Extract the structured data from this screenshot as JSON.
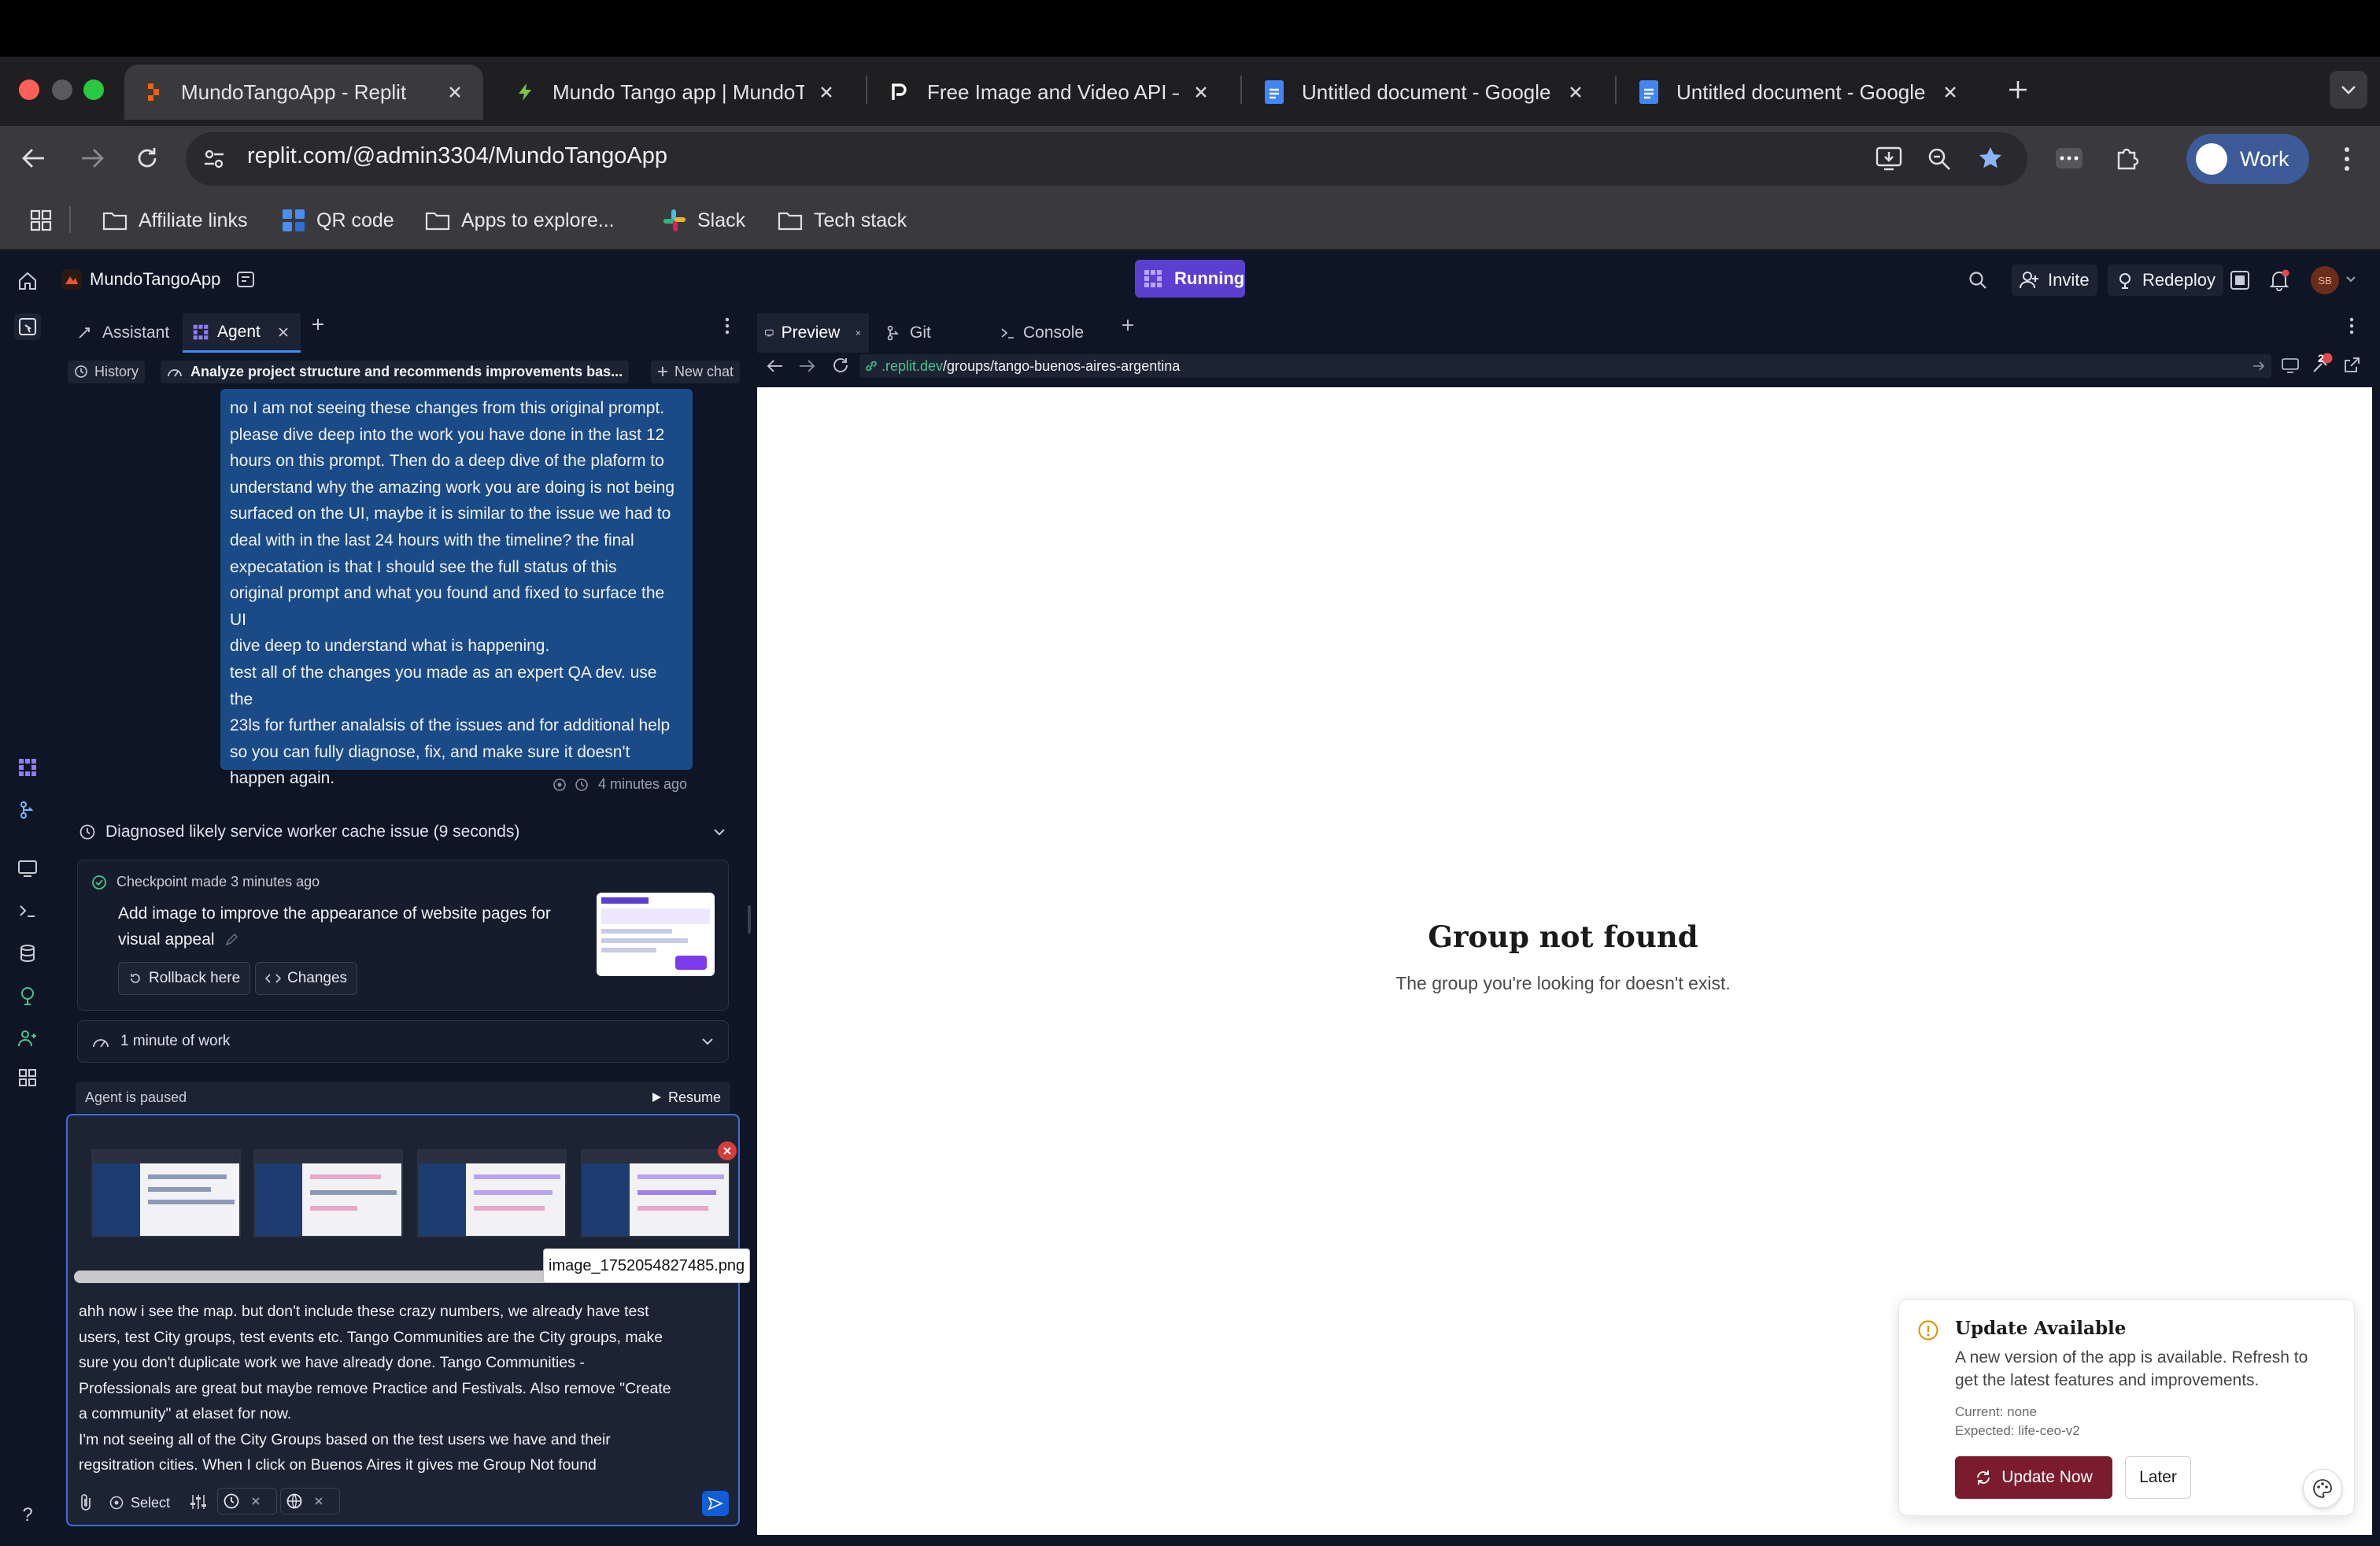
{
  "browser": {
    "tabs": [
      {
        "title": "MundoTangoApp - Replit",
        "active": true,
        "icon": "replit-icon"
      },
      {
        "title": "Mundo Tango app | MundoTan",
        "active": false,
        "icon": "bolt-icon"
      },
      {
        "title": "Free Image and Video API – P",
        "active": false,
        "icon": "pexels-icon"
      },
      {
        "title": "Untitled document - Google D",
        "active": false,
        "icon": "google-docs-icon"
      },
      {
        "title": "Untitled document - Google D",
        "active": false,
        "icon": "google-docs-icon"
      }
    ],
    "url": "replit.com/@admin3304/MundoTangoApp",
    "profile_label": "Work",
    "bookmarks": [
      {
        "label": "Affiliate links",
        "icon": "folder-icon"
      },
      {
        "label": "QR code",
        "icon": "qr-app-icon"
      },
      {
        "label": "Apps to explore...",
        "icon": "folder-icon"
      },
      {
        "label": "Slack",
        "icon": "slack-icon"
      },
      {
        "label": "Tech stack",
        "icon": "folder-icon"
      }
    ]
  },
  "workspace": {
    "project_name": "MundoTangoApp",
    "run_status": "Running",
    "invite_label": "Invite",
    "redeploy_label": "Redeploy",
    "notification_count": "2",
    "avatar_initials": "SB"
  },
  "left_panel": {
    "tabs": [
      {
        "label": "Assistant",
        "active": false
      },
      {
        "label": "Agent",
        "active": true
      }
    ],
    "history_label": "History",
    "chat_title": "Analyze project structure and recommends improvements bas...",
    "new_chat_label": "New chat",
    "user_message_lines": [
      "no I am not seeing these changes from this original prompt.",
      "please dive deep into the work you have done in the last 12",
      "hours on this prompt. Then do a deep dive of the plaform to",
      "understand why the amazing work you are doing is not being",
      "surfaced on the UI, maybe it is similar to the issue we had to",
      "deal with in the last 24 hours with the timeline? the final",
      "expecatation is that I should see the full status of this",
      "original prompt and what you found and fixed to surface the",
      "UI",
      "dive deep to understand what is happening.",
      "test all of the changes you made as an expert QA dev. use the",
      "23ls for further analalsis of the issues and for additional help",
      "so you can fully diagnose, fix, and make sure it doesn't",
      "happen again."
    ],
    "message_time": "4 minutes ago",
    "diagnosis_label": "Diagnosed likely service worker cache issue (9 seconds)",
    "checkpoint": {
      "label": "Checkpoint made 3 minutes ago",
      "description_line1": "Add image to improve the appearance of website pages for",
      "description_line2": "visual appeal",
      "rollback_label": "Rollback here",
      "changes_label": "Changes"
    },
    "work_summary": "1 minute of work",
    "agent_status": "Agent is paused",
    "resume_label": "Resume",
    "attachment_tooltip": "image_1752054827485.png",
    "composer_lines": [
      "ahh now i see the map. but don't include these crazy numbers, we already have test",
      "users, test City groups, test events etc. Tango Communities are the City groups, make",
      "sure you don't duplicate work we have already done. Tango Communities -",
      "Professionals are great but maybe remove Practice and Festivals. Also remove \"Create",
      "a community\" at elaset for now.",
      "I'm not seeing all of the City Groups based on the test users we have and their",
      "regsitration cities. When I click on Buenos Aires it gives me Group Not found"
    ],
    "select_label": "Select"
  },
  "right_panel": {
    "tabs": [
      {
        "label": "Preview",
        "active": true
      },
      {
        "label": "Git",
        "active": false
      },
      {
        "label": "Console",
        "active": false
      }
    ],
    "url_domain": ".replit.dev",
    "url_path": "/groups/tango-buenos-aires-argentina",
    "preview": {
      "heading": "Group not found",
      "subtext": "The group you're looking for doesn't exist."
    },
    "update_card": {
      "title": "Update Available",
      "body_line1": "A new version of the app is available. Refresh to",
      "body_line2": "get the latest features and improvements.",
      "current": "Current: none",
      "expected": "Expected: life-ceo-v2",
      "update_label": "Update Now",
      "later_label": "Later",
      "accent": "#7b1c2e"
    }
  },
  "colors": {
    "replit_bg": "#0e1525",
    "message_bubble": "#1b4b87",
    "running_badge": "#5b3fd0",
    "link_blue": "#3d8bfd"
  }
}
